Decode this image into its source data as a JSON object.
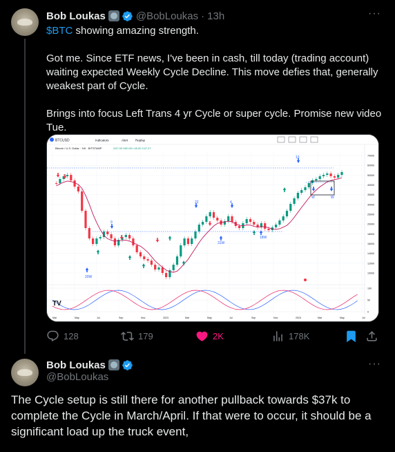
{
  "tweet1": {
    "author_name": "Bob Loukas",
    "handle": "@BobLoukas",
    "separator": "·",
    "time": "13h",
    "more_label": "···",
    "cashtag": "$BTC",
    "line1_rest": " showing amazing strength.",
    "para2": "Got me. Since ETF news, I've been in cash, till today (trading account) waiting expected Weekly Cycle Decline. This move defies that, generally weakest part of Cycle.",
    "para3": "Brings into focus Left Trans 4 yr Cycle or super cycle. Promise new video Tue.",
    "actions": {
      "replies": "128",
      "reposts": "179",
      "likes": "2K",
      "views": "178K"
    },
    "colors": {
      "link": "#1d9bf0",
      "like": "#f91880",
      "muted": "#71767b"
    }
  },
  "chart": {
    "symbol": "BTCUSD",
    "header": "Bitcoin / U.S. Dollar · 1W · BITSTAMP",
    "toolbar_indicators": "Indicators",
    "toolbar_alert": "Alert",
    "toolbar_replay": "Replay",
    "ohlc": "O47.00  H50.00  L40.00  C47.27",
    "price_ticks": [
      "70000",
      "60000",
      "50000",
      "40000",
      "35000",
      "30000",
      "25000",
      "20000",
      "18000",
      "16000",
      "14000",
      "12000",
      "10000"
    ],
    "time_ticks": [
      "Mar",
      "May",
      "Jul",
      "Sep",
      "Nov",
      "2023",
      "Mar",
      "May",
      "Jul",
      "Sep",
      "Nov",
      "2024",
      "Mar",
      "May",
      "Jul"
    ],
    "labels": {
      "l9": "9",
      "l20w": "20W",
      "l22": "22",
      "l4": "4",
      "l31w": "31W",
      "l18w": "18W",
      "l13": "13",
      "lw1": "W",
      "lw2": "W"
    },
    "osc_ticks": [
      "100",
      "50",
      "0"
    ]
  },
  "tweet2": {
    "author_name": "Bob Loukas",
    "handle": "@BobLoukas",
    "more_label": "···",
    "text": "The Cycle setup is still there for another pullback towards $37k to complete the Cycle in March/April.  If that were to occur, it should be a significant load up the truck event,"
  }
}
